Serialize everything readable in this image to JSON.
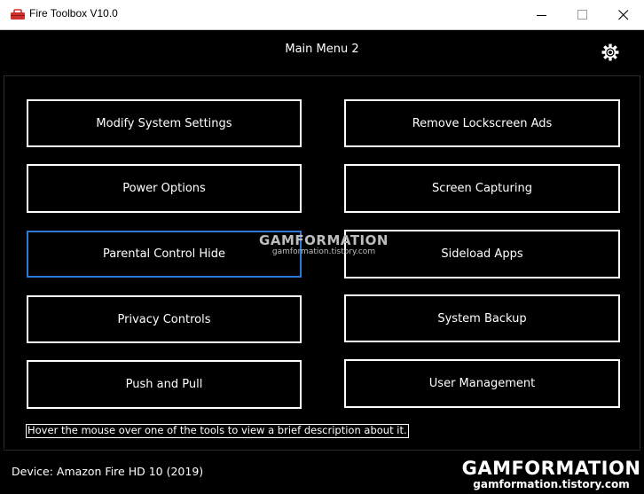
{
  "window": {
    "title": "Fire Toolbox V10.0",
    "icon": "fire-toolbox-icon",
    "controls": [
      "minimize",
      "maximize",
      "close"
    ]
  },
  "header": {
    "title": "Main Menu 2",
    "settings_icon": "gear-icon"
  },
  "menu": {
    "left": [
      "Modify System Settings",
      "Power Options",
      "Parental Control Hide",
      "Privacy Controls",
      "Push and Pull"
    ],
    "right": [
      "Remove Lockscreen Ads",
      "Screen Capturing",
      "Sideload Apps",
      "System Backup",
      "User Management"
    ],
    "focused": "Parental Control Hide"
  },
  "hint": "Hover the mouse over one of the tools to view a brief description about it.",
  "footer": {
    "device": "Device: Amazon Fire HD 10 (2019)"
  },
  "watermark": {
    "brand": "GAMFORMATION",
    "url": "gamformation.tistory.com"
  },
  "colors": {
    "background": "#000000",
    "button_border": "#ffffff",
    "focus_border": "#2f78d8",
    "titlebar": "#ffffff",
    "icon_red": "#d0312d"
  }
}
